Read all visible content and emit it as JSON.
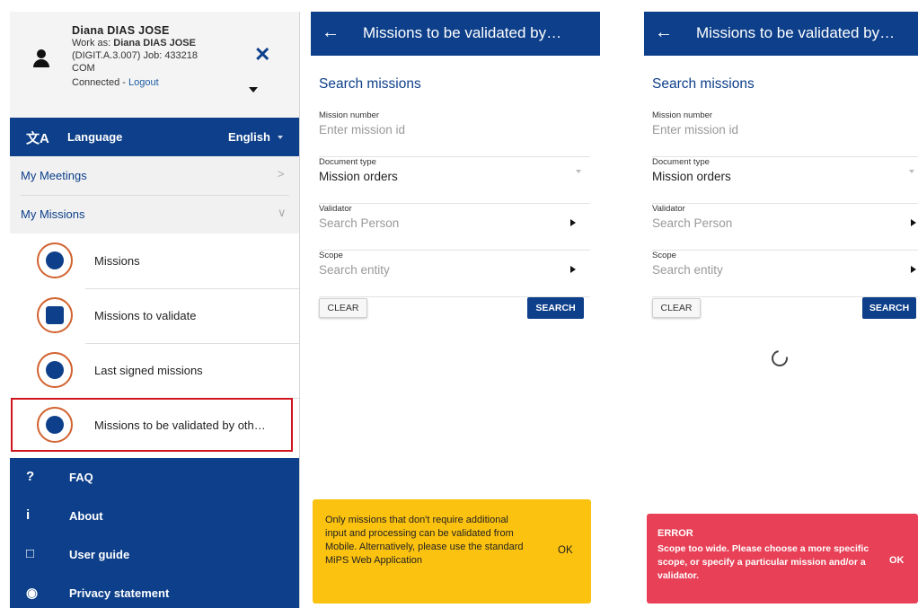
{
  "menu": {
    "user": {
      "name": "Diana DIAS JOSE",
      "work_as_prefix": "Work as: ",
      "work_as_name": "Diana DIAS JOSE",
      "line2": "(DIGIT.A.3.007) Job: 433218",
      "line3": "COM",
      "connected": "Connected - ",
      "logout": "Logout"
    },
    "language": {
      "label": "Language",
      "value": "English",
      "icon": "translate-icon"
    },
    "sections": [
      {
        "label": "My Meetings",
        "chevron": ">"
      },
      {
        "label": "My Missions",
        "chevron": "∨"
      }
    ],
    "sub_items": [
      {
        "label": "Missions",
        "icon": "briefcase-icon"
      },
      {
        "label": "Missions to validate",
        "icon": "clipboard-check-icon"
      },
      {
        "label": "Last signed missions",
        "icon": "pen-icon"
      },
      {
        "label": "Missions to be validated by oth…",
        "icon": "search-icon"
      }
    ],
    "footer_items": [
      {
        "label": "FAQ",
        "icon": "?"
      },
      {
        "label": "About",
        "icon": "i"
      },
      {
        "label": "User guide",
        "icon": "□"
      },
      {
        "label": "Privacy statement",
        "icon": "◉"
      }
    ]
  },
  "screen": {
    "title": "Missions to be validated by…",
    "back": "←",
    "section_title": "Search missions",
    "fields": {
      "mission_number": {
        "label": "Mission number",
        "placeholder": "Enter mission id"
      },
      "document_type": {
        "label": "Document type",
        "value": "Mission orders"
      },
      "validator": {
        "label": "Validator",
        "placeholder": "Search Person"
      },
      "scope": {
        "label": "Scope",
        "placeholder": "Search entity"
      }
    },
    "clear_label": "CLEAR",
    "search_label": "SEARCH"
  },
  "warning_toast": {
    "message": "Only missions that don't require additional input and processing can be validated from Mobile. Alternatively, please use the standard MiPS Web Application",
    "ok": "OK"
  },
  "error_toast": {
    "title": "ERROR",
    "message": "Scope too wide. Please choose a more specific scope, or specify a particular mission and/or a validator.",
    "ok": "OK"
  },
  "colors": {
    "primary": "#0d3f8a",
    "accent_ring": "#d2622f",
    "highlight": "#d0151e",
    "warning": "#fcc210",
    "error": "#e84157"
  }
}
